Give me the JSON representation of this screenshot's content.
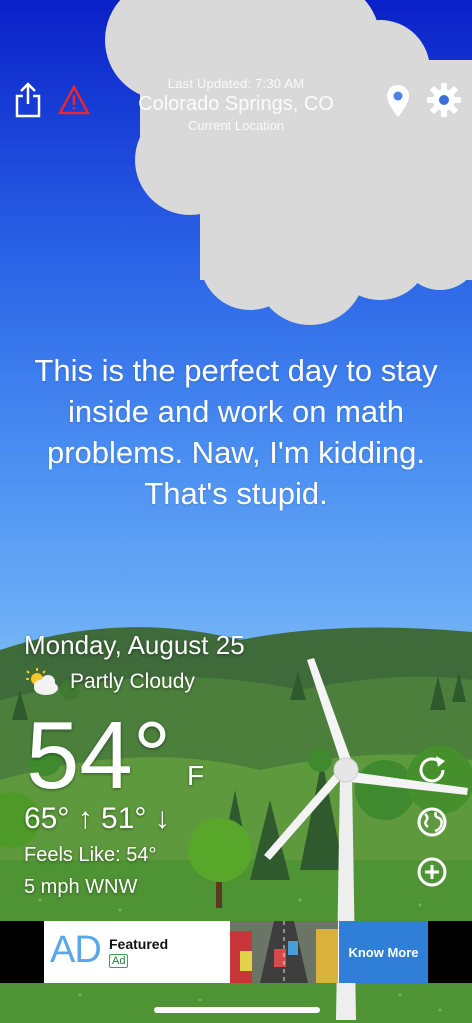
{
  "header": {
    "last_updated": "Last Updated: 7:30 AM",
    "city": "Colorado Springs, CO",
    "location_sub": "Current Location",
    "icons": [
      "share-icon",
      "alert-triangle-icon",
      "location-pin-icon",
      "gear-icon"
    ]
  },
  "quote": "This is the perfect day to stay inside and work on math problems. Naw, I'm kidding. That's stupid.",
  "weather": {
    "date": "Monday, August 25",
    "condition": "Partly Cloudy",
    "temperature": "54°",
    "unit": "F",
    "high_low": "65° ↑  51° ↓",
    "feels_like": "Feels Like: 54°",
    "wind": "5 mph WNW"
  },
  "side_buttons": [
    "refresh-icon",
    "globe-icon",
    "add-icon"
  ],
  "ad": {
    "logo": "AD",
    "title": "Featured",
    "tag": "Ad",
    "cta": "Know More"
  },
  "colors": {
    "sky_top": "#0a20c8",
    "sky_bottom": "#86c2f4",
    "grass": "#3f8a2e",
    "ad_button": "#2f7ed8"
  }
}
